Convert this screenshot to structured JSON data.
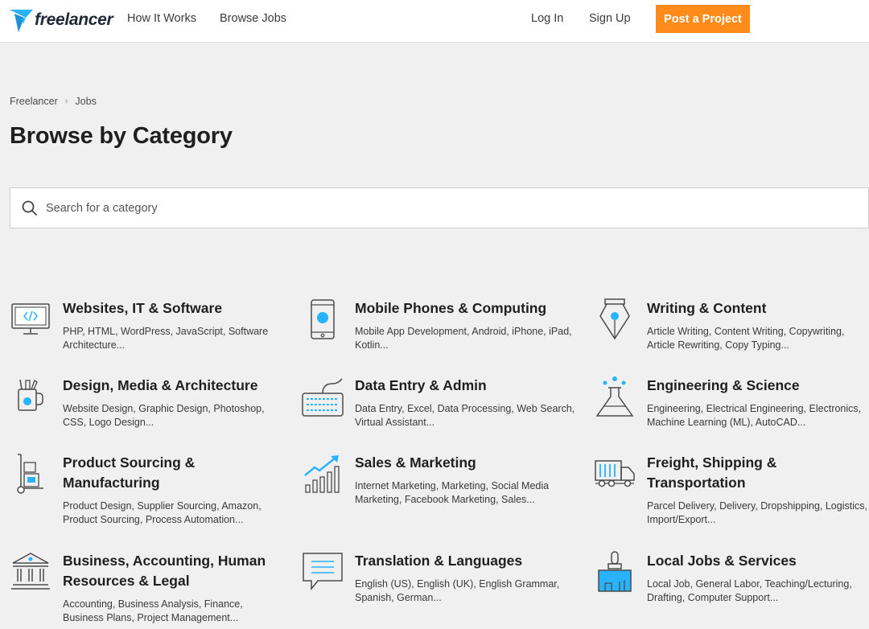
{
  "header": {
    "logo_text": "freelancer",
    "nav": {
      "how_it_works": "How It Works",
      "browse_jobs": "Browse Jobs"
    },
    "login": "Log In",
    "signup": "Sign Up",
    "post_project": "Post a Project"
  },
  "breadcrumb": {
    "home": "Freelancer",
    "current": "Jobs"
  },
  "page_title": "Browse by Category",
  "search": {
    "placeholder": "Search for a category",
    "value": ""
  },
  "categories": [
    {
      "title": "Websites, IT & Software",
      "desc": "PHP, HTML, WordPress, JavaScript, Software Architecture...",
      "icon": "monitor-code-icon"
    },
    {
      "title": "Mobile Phones & Computing",
      "desc": "Mobile App Development, Android, iPhone, iPad, Kotlin...",
      "icon": "mobile-phone-icon"
    },
    {
      "title": "Writing & Content",
      "desc": "Article Writing, Content Writing, Copywriting, Article Rewriting, Copy Typing...",
      "icon": "pen-nib-icon"
    },
    {
      "title": "Design, Media & Architecture",
      "desc": "Website Design, Graphic Design, Photoshop, CSS, Logo Design...",
      "icon": "pencil-cup-icon"
    },
    {
      "title": "Data Entry & Admin",
      "desc": "Data Entry, Excel, Data Processing, Web Search, Virtual Assistant...",
      "icon": "keyboard-icon"
    },
    {
      "title": "Engineering & Science",
      "desc": "Engineering, Electrical Engineering, Electronics, Machine Learning (ML), AutoCAD...",
      "icon": "flask-icon"
    },
    {
      "title": "Product Sourcing & Manufacturing",
      "desc": "Product Design, Supplier Sourcing, Amazon, Product Sourcing, Process Automation...",
      "icon": "hand-truck-icon"
    },
    {
      "title": "Sales & Marketing",
      "desc": "Internet Marketing, Marketing, Social Media Marketing, Facebook Marketing, Sales...",
      "icon": "growth-chart-icon"
    },
    {
      "title": "Freight, Shipping & Transportation",
      "desc": "Parcel Delivery, Delivery, Dropshipping, Logistics, Import/Export...",
      "icon": "truck-icon"
    },
    {
      "title": "Business, Accounting, Human Resources & Legal",
      "desc": "Accounting, Business Analysis, Finance, Business Plans, Project Management...",
      "icon": "bank-building-icon"
    },
    {
      "title": "Translation & Languages",
      "desc": "English (US), English (UK), English Grammar, Spanish, German...",
      "icon": "speech-bubble-icon"
    },
    {
      "title": "Local Jobs & Services",
      "desc": "Local Job, General Labor, Teaching/Lecturing, Drafting, Computer Support...",
      "icon": "paint-brush-icon"
    }
  ],
  "colors": {
    "accent_orange": "#ff8c1a",
    "brand_blue": "#29b2fe",
    "icon_stroke": "#4a4a4a"
  }
}
